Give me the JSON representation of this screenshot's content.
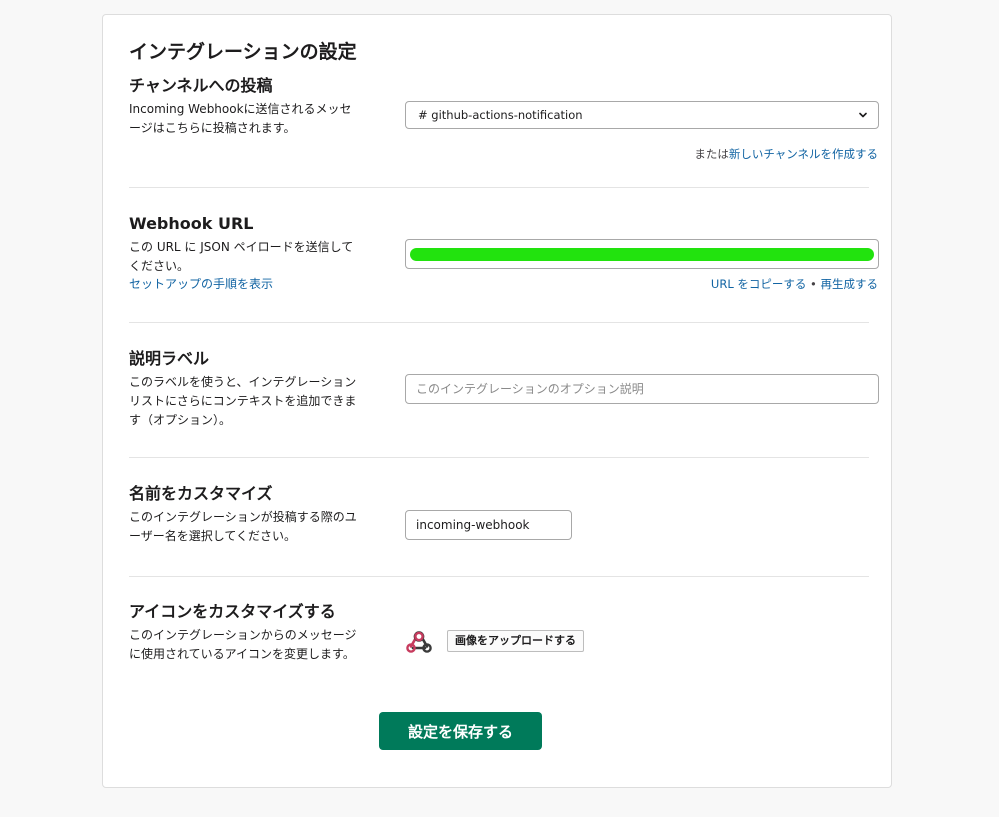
{
  "page": {
    "title": "インテグレーションの設定"
  },
  "channel": {
    "title": "チャンネルへの投稿",
    "description": "Incoming Webhookに送信されるメッセージはこちらに投稿されます。",
    "selected": "# github-actions-notification",
    "helper_prefix": "または",
    "helper_link": "新しいチャンネルを作成する"
  },
  "webhook": {
    "title": "Webhook URL",
    "description": "この URL に JSON ペイロードを送信してください。",
    "setup_link": "セットアップの手順を表示",
    "copy_link": "URL をコピーする",
    "separator": "•",
    "regenerate_link": "再生成する",
    "redaction_color": "#22e30e"
  },
  "label": {
    "title": "説明ラベル",
    "description": "このラベルを使うと、インテグレーションリストにさらにコンテキストを追加できます（オプション）。",
    "placeholder": "このインテグレーションのオプション説明"
  },
  "name": {
    "title": "名前をカスタマイズ",
    "description": "このインテグレーションが投稿する際のユーザー名を選択してください。",
    "value": "incoming-webhook"
  },
  "icon": {
    "title": "アイコンをカスタマイズする",
    "description": "このインテグレーションからのメッセージに使用されているアイコンを変更します。",
    "icon_name": "webhook-icon",
    "upload_label": "画像をアップロードする"
  },
  "save": {
    "label": "設定を保存する",
    "color": "#007a5a"
  }
}
